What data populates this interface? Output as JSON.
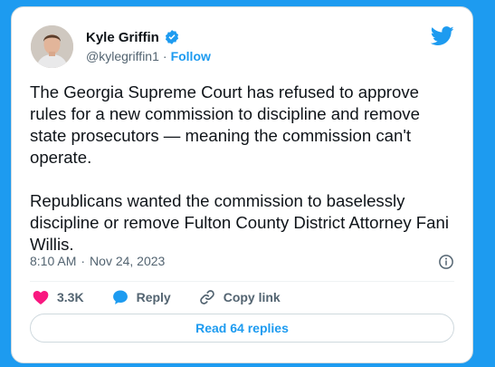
{
  "author": {
    "name": "Kyle Griffin",
    "handle": "@kylegriffin1",
    "separator": "·",
    "follow_label": "Follow"
  },
  "tweet": {
    "paragraphs": [
      "The Georgia Supreme Court has refused to approve rules for a new commission to discipline and remove state prosecutors — meaning the commission can't operate.",
      "Republicans wanted the commission to baselessly discipline or remove Fulton County District Attorney Fani Willis."
    ],
    "time": "8:10 AM",
    "separator": "·",
    "date": "Nov 24, 2023"
  },
  "actions": {
    "likes": "3.3K",
    "reply_label": "Reply",
    "copy_link_label": "Copy link"
  },
  "read_replies_label": "Read 64 replies",
  "icons": {
    "brand": "twitter-bird-icon",
    "verified": "verified-badge-icon",
    "info": "info-icon",
    "heart": "heart-icon",
    "reply": "reply-bubble-icon",
    "link": "link-icon"
  },
  "colors": {
    "accent": "#1d9bf0",
    "heart": "#f91880",
    "text": "#0f1419",
    "muted": "#536471"
  }
}
